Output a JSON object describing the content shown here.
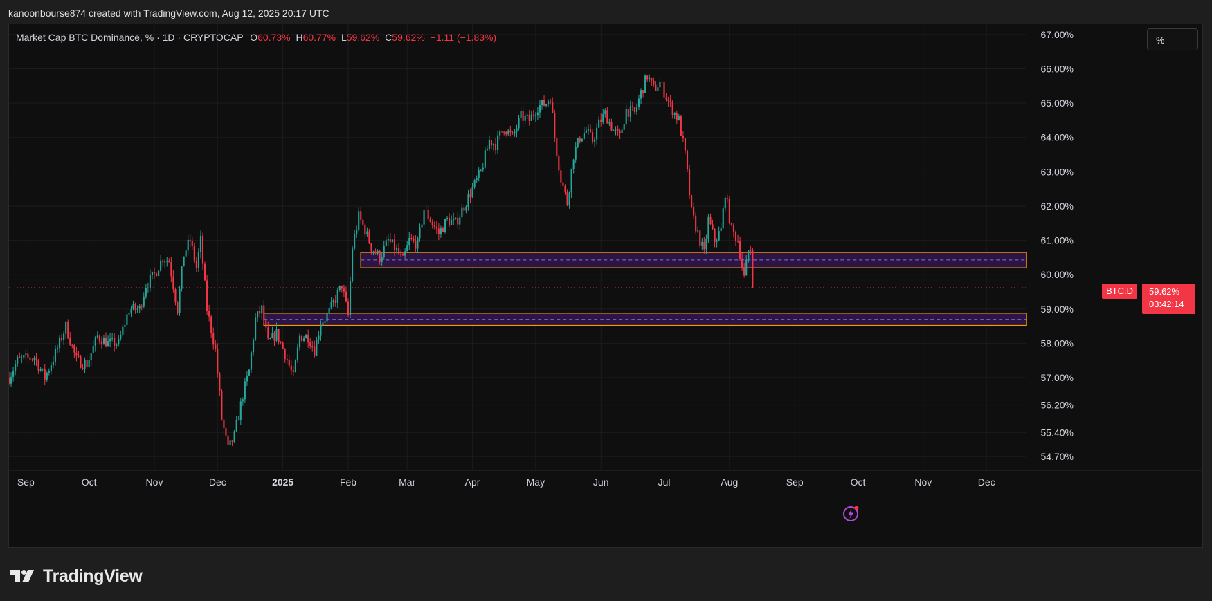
{
  "attribution": "kanoonbourse874 created with TradingView.com, Aug 12, 2025 20:17 UTC",
  "legend": {
    "title": "Market Cap BTC Dominance, % · 1D · CRYPTOCAP",
    "o_label": "O",
    "o_value": "60.73%",
    "h_label": "H",
    "h_value": "60.77%",
    "l_label": "L",
    "l_value": "59.62%",
    "c_label": "C",
    "c_value": "59.62%",
    "change": "−1.11 (−1.83%)"
  },
  "scale_button": "%",
  "symbol_tag": "BTC.D",
  "price_tag": {
    "price": "59.62%",
    "countdown": "03:42:14"
  },
  "footer": {
    "brand": "TradingView"
  },
  "colors": {
    "up": "#26a69a",
    "down": "#f23645",
    "zone_border": "#ff9800",
    "zone_fill": "#2a1545",
    "zone_mid": "#9c6bdb",
    "grid": "#1c1c1c",
    "background": "#0f0f0f"
  },
  "chart_data": {
    "type": "candlestick",
    "title": "Market Cap BTC Dominance, % · 1D · CRYPTOCAP",
    "interval": "1D",
    "x_range": [
      "2024-08-24",
      "2025-12-20"
    ],
    "y_range": [
      54.3,
      67.3
    ],
    "y_ticks": [
      {
        "value": 67.0,
        "label": "67.00%"
      },
      {
        "value": 66.0,
        "label": "66.00%"
      },
      {
        "value": 65.0,
        "label": "65.00%"
      },
      {
        "value": 64.0,
        "label": "64.00%"
      },
      {
        "value": 63.0,
        "label": "63.00%"
      },
      {
        "value": 62.0,
        "label": "62.00%"
      },
      {
        "value": 61.0,
        "label": "61.00%"
      },
      {
        "value": 60.0,
        "label": "60.00%"
      },
      {
        "value": 59.0,
        "label": "59.00%"
      },
      {
        "value": 58.0,
        "label": "58.00%"
      },
      {
        "value": 57.0,
        "label": "57.00%"
      },
      {
        "value": 56.2,
        "label": "56.20%"
      },
      {
        "value": 55.4,
        "label": "55.40%"
      },
      {
        "value": 54.7,
        "label": "54.70%"
      }
    ],
    "x_ticks": [
      {
        "date": "2024-09-01",
        "label": "Sep",
        "bold": false
      },
      {
        "date": "2024-10-01",
        "label": "Oct",
        "bold": false
      },
      {
        "date": "2024-11-01",
        "label": "Nov",
        "bold": false
      },
      {
        "date": "2024-12-01",
        "label": "Dec",
        "bold": false
      },
      {
        "date": "2025-01-01",
        "label": "2025",
        "bold": true
      },
      {
        "date": "2025-02-01",
        "label": "Feb",
        "bold": false
      },
      {
        "date": "2025-03-01",
        "label": "Mar",
        "bold": false
      },
      {
        "date": "2025-04-01",
        "label": "Apr",
        "bold": false
      },
      {
        "date": "2025-05-01",
        "label": "May",
        "bold": false
      },
      {
        "date": "2025-06-01",
        "label": "Jun",
        "bold": false
      },
      {
        "date": "2025-07-01",
        "label": "Jul",
        "bold": false
      },
      {
        "date": "2025-08-01",
        "label": "Aug",
        "bold": false
      },
      {
        "date": "2025-09-01",
        "label": "Sep",
        "bold": false
      },
      {
        "date": "2025-10-01",
        "label": "Oct",
        "bold": false
      },
      {
        "date": "2025-11-01",
        "label": "Nov",
        "bold": false
      },
      {
        "date": "2025-12-01",
        "label": "Dec",
        "bold": false
      }
    ],
    "close_path": [
      [
        "2024-08-24",
        57.0
      ],
      [
        "2024-08-28",
        57.5
      ],
      [
        "2024-09-05",
        57.6
      ],
      [
        "2024-09-10",
        57.0
      ],
      [
        "2024-09-15",
        57.7
      ],
      [
        "2024-09-20",
        58.5
      ],
      [
        "2024-09-25",
        57.5
      ],
      [
        "2024-09-30",
        57.4
      ],
      [
        "2024-10-05",
        58.2
      ],
      [
        "2024-10-10",
        58.0
      ],
      [
        "2024-10-15",
        58.0
      ],
      [
        "2024-10-20",
        59.0
      ],
      [
        "2024-10-25",
        59.0
      ],
      [
        "2024-10-28",
        59.7
      ],
      [
        "2024-11-01",
        60.0
      ],
      [
        "2024-11-05",
        60.5
      ],
      [
        "2024-11-08",
        60.4
      ],
      [
        "2024-11-12",
        59.0
      ],
      [
        "2024-11-15",
        60.6
      ],
      [
        "2024-11-18",
        61.0
      ],
      [
        "2024-11-21",
        60.2
      ],
      [
        "2024-11-23",
        61.0
      ],
      [
        "2024-11-26",
        59.0
      ],
      [
        "2024-11-30",
        57.8
      ],
      [
        "2024-12-03",
        55.8
      ],
      [
        "2024-12-06",
        54.9
      ],
      [
        "2024-12-09",
        55.3
      ],
      [
        "2024-12-13",
        56.5
      ],
      [
        "2024-12-16",
        57.2
      ],
      [
        "2024-12-19",
        58.7
      ],
      [
        "2024-12-22",
        59.0
      ],
      [
        "2024-12-25",
        58.0
      ],
      [
        "2024-12-29",
        58.3
      ],
      [
        "2025-01-02",
        57.7
      ],
      [
        "2025-01-06",
        57.0
      ],
      [
        "2025-01-09",
        58.2
      ],
      [
        "2025-01-13",
        58.2
      ],
      [
        "2025-01-16",
        57.8
      ],
      [
        "2025-01-19",
        58.6
      ],
      [
        "2025-01-22",
        58.8
      ],
      [
        "2025-01-26",
        59.3
      ],
      [
        "2025-01-29",
        59.7
      ],
      [
        "2025-02-01",
        58.8
      ],
      [
        "2025-02-03",
        60.8
      ],
      [
        "2025-02-06",
        61.7
      ],
      [
        "2025-02-09",
        61.3
      ],
      [
        "2025-02-12",
        60.8
      ],
      [
        "2025-02-16",
        60.5
      ],
      [
        "2025-02-20",
        61.0
      ],
      [
        "2025-02-24",
        60.7
      ],
      [
        "2025-02-27",
        60.4
      ],
      [
        "2025-03-02",
        61.0
      ],
      [
        "2025-03-06",
        60.9
      ],
      [
        "2025-03-09",
        61.9
      ],
      [
        "2025-03-12",
        61.6
      ],
      [
        "2025-03-16",
        61.2
      ],
      [
        "2025-03-20",
        61.6
      ],
      [
        "2025-03-24",
        61.5
      ],
      [
        "2025-03-28",
        62.0
      ],
      [
        "2025-04-01",
        62.5
      ],
      [
        "2025-04-05",
        63.0
      ],
      [
        "2025-04-09",
        63.9
      ],
      [
        "2025-04-12",
        63.8
      ],
      [
        "2025-04-16",
        64.3
      ],
      [
        "2025-04-20",
        64.0
      ],
      [
        "2025-04-24",
        64.6
      ],
      [
        "2025-04-28",
        64.5
      ],
      [
        "2025-05-02",
        64.9
      ],
      [
        "2025-05-06",
        65.0
      ],
      [
        "2025-05-08",
        65.2
      ],
      [
        "2025-05-10",
        64.0
      ],
      [
        "2025-05-13",
        62.8
      ],
      [
        "2025-05-16",
        62.1
      ],
      [
        "2025-05-19",
        63.5
      ],
      [
        "2025-05-22",
        64.0
      ],
      [
        "2025-05-25",
        64.2
      ],
      [
        "2025-05-28",
        63.9
      ],
      [
        "2025-05-31",
        64.4
      ],
      [
        "2025-06-03",
        64.7
      ],
      [
        "2025-06-07",
        64.2
      ],
      [
        "2025-06-10",
        64.0
      ],
      [
        "2025-06-13",
        64.8
      ],
      [
        "2025-06-17",
        64.7
      ],
      [
        "2025-06-20",
        65.3
      ],
      [
        "2025-06-23",
        65.8
      ],
      [
        "2025-06-26",
        65.4
      ],
      [
        "2025-06-29",
        65.6
      ],
      [
        "2025-07-02",
        65.2
      ],
      [
        "2025-07-05",
        64.8
      ],
      [
        "2025-07-08",
        64.5
      ],
      [
        "2025-07-11",
        63.5
      ],
      [
        "2025-07-14",
        61.8
      ],
      [
        "2025-07-17",
        61.2
      ],
      [
        "2025-07-20",
        60.6
      ],
      [
        "2025-07-22",
        61.6
      ],
      [
        "2025-07-25",
        61.0
      ],
      [
        "2025-07-28",
        61.3
      ],
      [
        "2025-07-30",
        62.4
      ],
      [
        "2025-08-02",
        61.3
      ],
      [
        "2025-08-05",
        61.0
      ],
      [
        "2025-08-08",
        59.9
      ],
      [
        "2025-08-10",
        60.7
      ],
      [
        "2025-08-11",
        60.73
      ],
      [
        "2025-08-12",
        59.62
      ]
    ],
    "last_candle": {
      "date": "2025-08-12",
      "open": 60.73,
      "high": 60.77,
      "low": 59.62,
      "close": 59.62
    },
    "last_price_line": 59.62,
    "zones": [
      {
        "start": "2025-02-07",
        "top": 60.65,
        "bottom": 60.2,
        "mid": 60.43
      },
      {
        "start": "2024-12-23",
        "top": 58.88,
        "bottom": 58.52,
        "mid": 58.7
      }
    ]
  }
}
